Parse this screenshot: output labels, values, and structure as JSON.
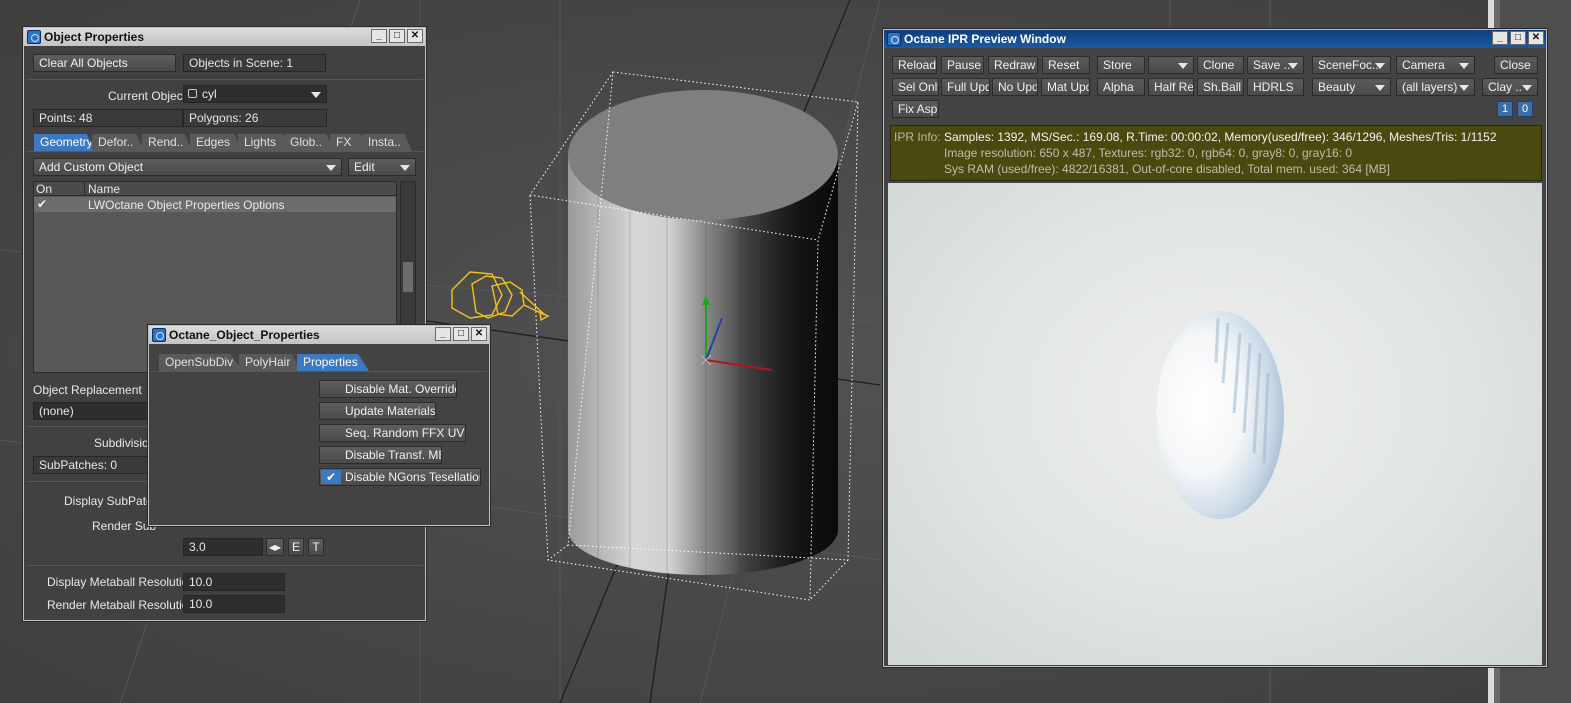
{
  "obj_props": {
    "title": "Object Properties",
    "clear_all": "Clear All Objects",
    "objects_in_scene": "Objects in Scene: 1",
    "current_object_label": "Current Object",
    "current_object_value": "cyl",
    "points": "Points: 48",
    "polygons": "Polygons: 26",
    "tabs": [
      "Geometry",
      "Defor..",
      "Rend..",
      "Edges",
      "Lights",
      "Glob..",
      "FX",
      "Insta.."
    ],
    "add_custom_object": "Add Custom Object",
    "edit": "Edit",
    "col_on": "On",
    "col_name": "Name",
    "row_check": "✔",
    "row_name": "LWOctane Object Properties Options",
    "object_replacement": "Object Replacement",
    "replacement_value": "(none)",
    "subdivision_label": "Subdivision",
    "subpatches": "SubPatches: 0",
    "display_subpatch": "Display SubPatch",
    "render_subpatch": "Render Sub",
    "render_sub_value": "3.0",
    "e_btn": "E",
    "t_btn": "T",
    "display_metaball_label": "Display Metaball Resolution",
    "display_metaball_value": "10.0",
    "render_metaball_label": "Render Metaball Resolution",
    "render_metaball_value": "10.0"
  },
  "octane_obj": {
    "title": "Octane_Object_Properties",
    "tabs": [
      "OpenSubDiv",
      "PolyHair",
      "Properties"
    ],
    "buttons": [
      {
        "label": "Disable Mat. Override",
        "checked": false
      },
      {
        "label": "Update Materials",
        "checked": false
      },
      {
        "label": "Seq. Random FFX UVs",
        "checked": false
      },
      {
        "label": "Disable Transf. MB",
        "checked": false
      },
      {
        "label": "Disable NGons Tesellation",
        "checked": true
      }
    ],
    "check_glyph": "✔"
  },
  "ipr": {
    "title": "Octane IPR Preview Window",
    "row1": [
      "Reload",
      "Pause",
      "Redraw",
      "Reset",
      "Store",
      "",
      "Clone",
      "Save ..",
      "SceneFoc..",
      "Camera",
      "Close"
    ],
    "row2": [
      "Sel Only",
      "Full Upd.",
      "No Upd.",
      "Mat Upd",
      "Alpha",
      "Half Res",
      "Sh.Ball",
      "HDRLS",
      "Beauty",
      "(all layers)",
      "Clay .."
    ],
    "fix_asp": "Fix Asp.",
    "num1": "1",
    "num2": "0",
    "info_label": "IPR Info:",
    "info_line1": "Samples: 1392, MS/Sec.: 169.08, R.Time: 00:00:02, Memory(used/free): 346/1296, Meshes/Tris: 1/1152",
    "info_line2": "Image resolution:  650 x 487, Textures:  rgb32: 0, rgb64: 0, gray8: 0, gray16: 0",
    "info_line3": "Sys RAM (used/free): 4822/16381, Out-of-core disabled, Total mem. used: 364  [MB]"
  },
  "colors": {
    "accent": "#3d78c2",
    "info_bg": "#4a4a10",
    "render_bg": "#dfe3e2"
  }
}
